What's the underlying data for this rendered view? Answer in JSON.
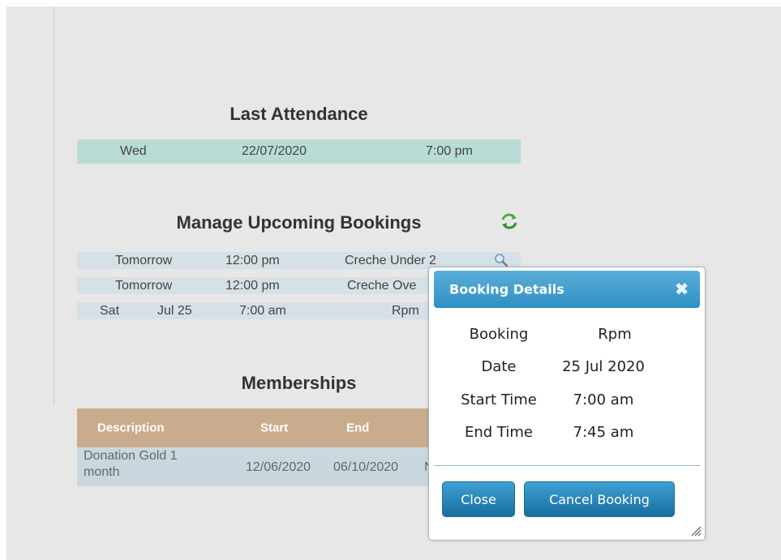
{
  "last_attendance": {
    "title": "Last Attendance",
    "day": "Wed",
    "date": "22/07/2020",
    "time": "7:00 pm"
  },
  "bookings": {
    "title": "Manage Upcoming Bookings",
    "refresh_icon": "refresh-icon",
    "rows": [
      {
        "day": "Tomorrow",
        "time": "12:00 pm",
        "class": "Creche Under 2"
      },
      {
        "day": "Tomorrow",
        "time": "12:00 pm",
        "class": "Creche Ove"
      },
      {
        "day": "Sat",
        "date": "Jul 25",
        "time": "7:00 am",
        "class": "Rpm"
      }
    ]
  },
  "memberships": {
    "title": "Memberships",
    "headers": {
      "description": "Description",
      "start": "Start",
      "end": "End"
    },
    "rows": [
      {
        "description_line1": "Donation Gold 1",
        "description_line2": "month",
        "start": "12/06/2020",
        "end": "06/10/2020",
        "extra": "N"
      }
    ]
  },
  "dialog": {
    "title": "Booking Details",
    "close_glyph": "✖",
    "fields": [
      {
        "label": "Booking",
        "value": "Rpm"
      },
      {
        "label": "Date",
        "value": "25 Jul 2020"
      },
      {
        "label": "Start Time",
        "value": "7:00 am"
      },
      {
        "label": "End Time",
        "value": "7:45 am"
      }
    ],
    "close_button": "Close",
    "cancel_button": "Cancel Booking"
  },
  "colors": {
    "attendance_row": "#b9ddd6",
    "booking_row": "#d6e0e7",
    "membership_header": "#c9ac8e",
    "membership_row": "#c9d8df",
    "dialog_accent": "#2f8fc4"
  }
}
